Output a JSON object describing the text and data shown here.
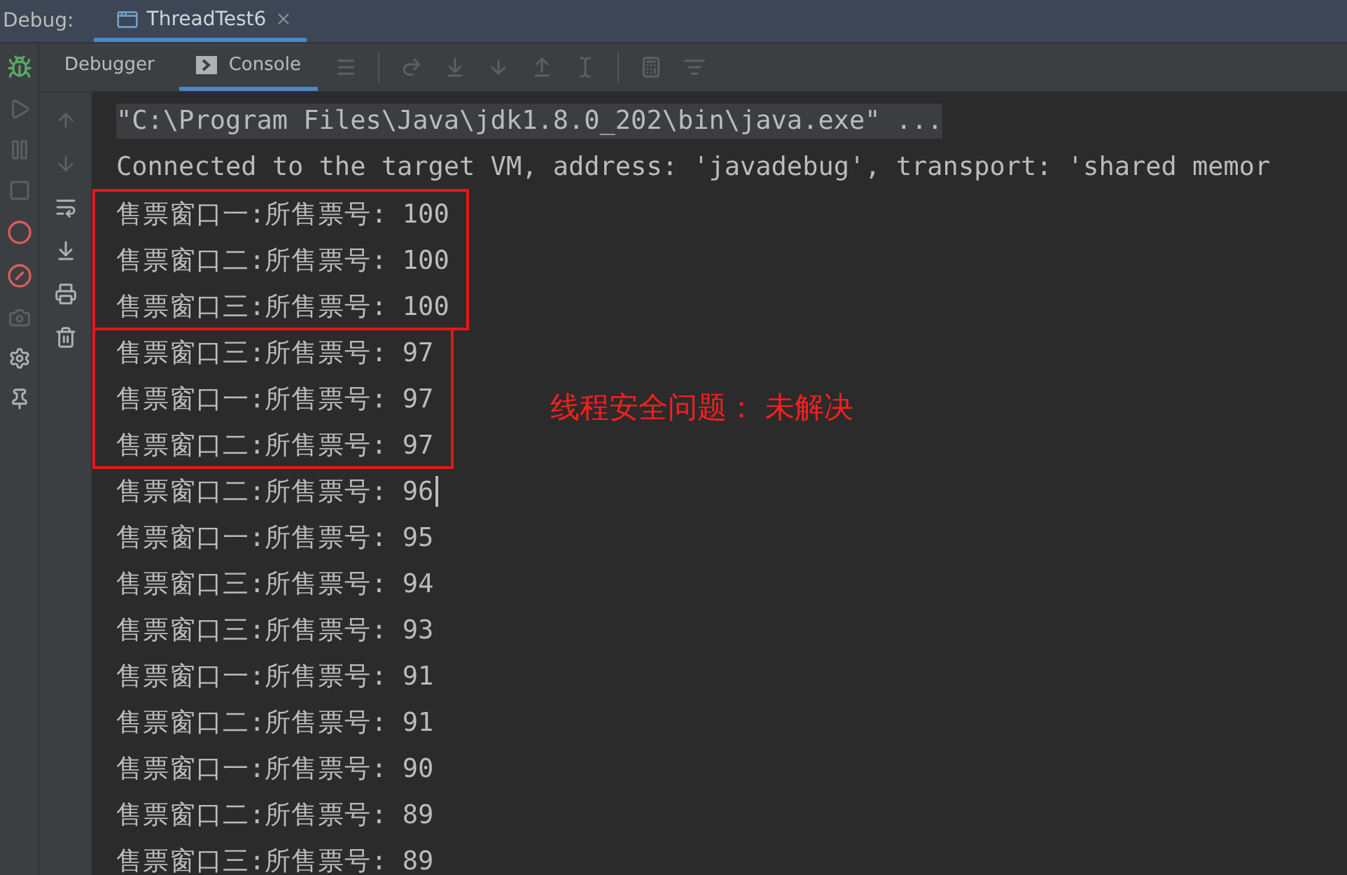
{
  "debug_bar": {
    "label": "Debug:",
    "tabs": [
      {
        "label": "ThreadTest6",
        "selected": true
      }
    ]
  },
  "panel_tabs": [
    {
      "label": "Debugger",
      "selected": false
    },
    {
      "label": "Console",
      "selected": true
    }
  ],
  "console": {
    "blocks": [
      {
        "boxed": false,
        "lines": [
          {
            "text": "\"C:\\Program Files\\Java\\jdk1.8.0_202\\bin\\java.exe\" ...",
            "kind": "command",
            "caret": false
          },
          {
            "text": "Connected to the target VM, address: 'javadebug', transport: 'shared memor",
            "kind": "output",
            "caret": false
          }
        ]
      },
      {
        "boxed": true,
        "lines": [
          {
            "text": "售票窗口一:所售票号: 100",
            "kind": "output",
            "caret": false
          },
          {
            "text": "售票窗口二:所售票号: 100",
            "kind": "output",
            "caret": false
          },
          {
            "text": "售票窗口三:所售票号: 100",
            "kind": "output",
            "caret": false
          }
        ]
      },
      {
        "boxed": true,
        "note": "线程安全问题： 未解决",
        "lines": [
          {
            "text": "售票窗口三:所售票号: 97",
            "kind": "output",
            "caret": false
          },
          {
            "text": "售票窗口一:所售票号: 97",
            "kind": "output",
            "caret": false
          },
          {
            "text": "售票窗口二:所售票号: 97",
            "kind": "output",
            "caret": false
          }
        ]
      },
      {
        "boxed": false,
        "lines": [
          {
            "text": "售票窗口二:所售票号: 96",
            "kind": "output",
            "caret": true
          },
          {
            "text": "售票窗口一:所售票号: 95",
            "kind": "output",
            "caret": false
          },
          {
            "text": "售票窗口三:所售票号: 94",
            "kind": "output",
            "caret": false
          },
          {
            "text": "售票窗口三:所售票号: 93",
            "kind": "output",
            "caret": false
          },
          {
            "text": "售票窗口一:所售票号: 91",
            "kind": "output",
            "caret": false
          },
          {
            "text": "售票窗口二:所售票号: 91",
            "kind": "output",
            "caret": false
          },
          {
            "text": "售票窗口一:所售票号: 90",
            "kind": "output",
            "caret": false
          },
          {
            "text": "售票窗口二:所售票号: 89",
            "kind": "output",
            "caret": false
          },
          {
            "text": "售票窗口三:所售票号: 89",
            "kind": "output",
            "caret": false
          }
        ]
      }
    ]
  }
}
